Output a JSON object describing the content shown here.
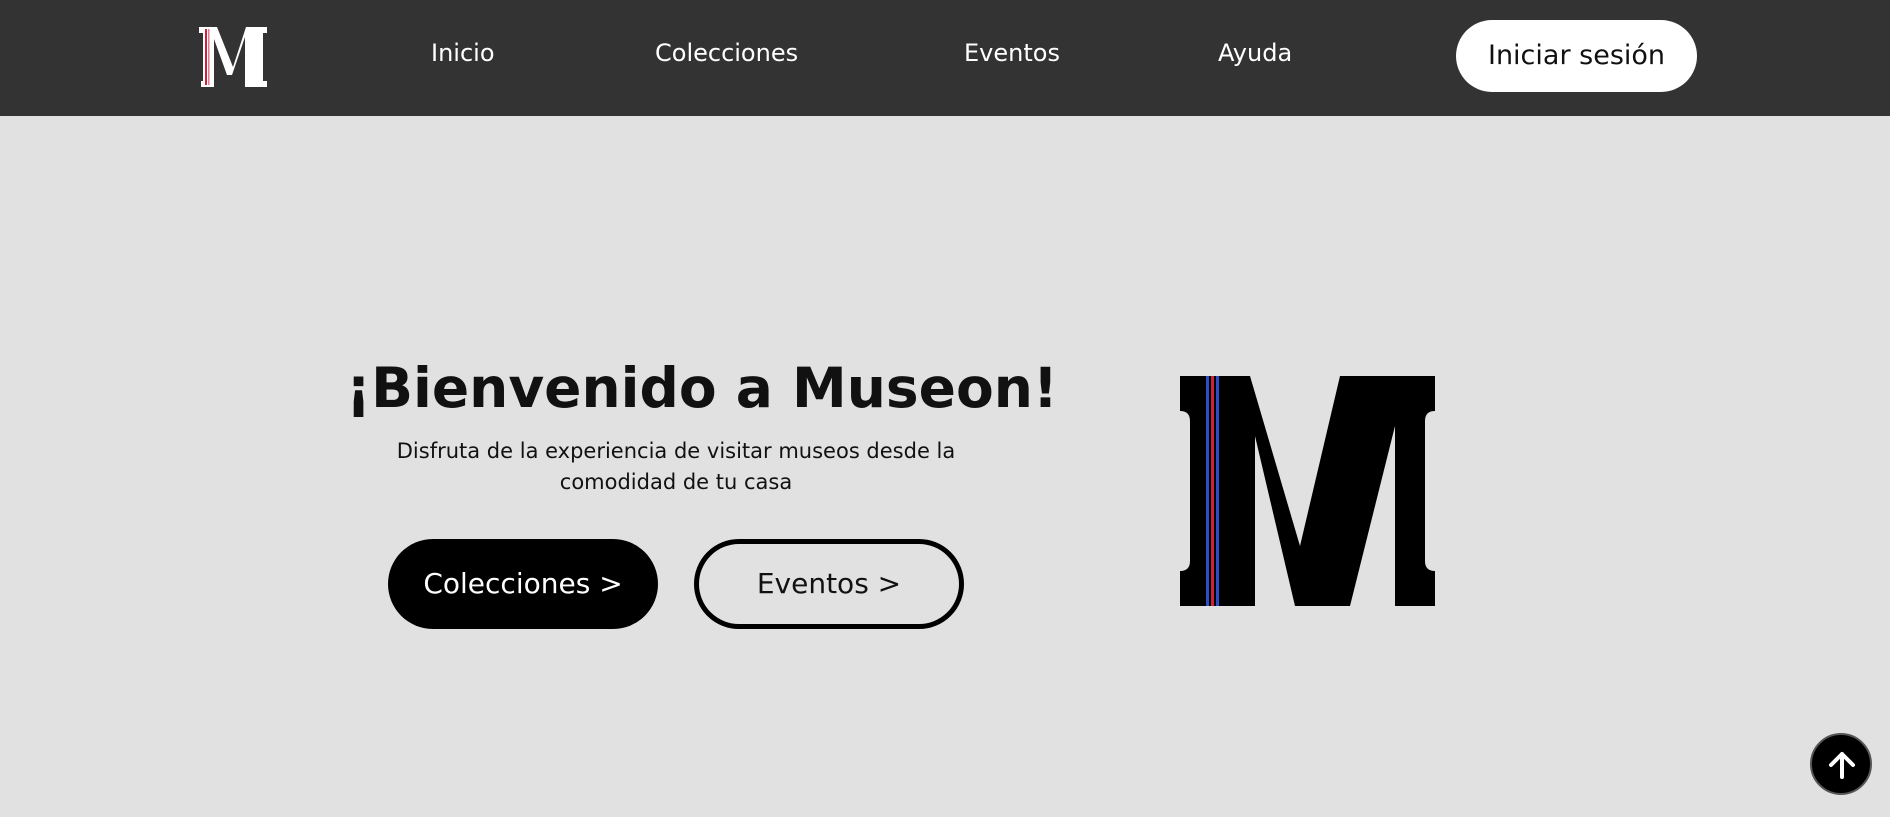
{
  "nav": {
    "logo_icon": "museon-m-logo",
    "links": [
      {
        "label": "Inicio"
      },
      {
        "label": "Colecciones"
      },
      {
        "label": "Eventos"
      },
      {
        "label": "Ayuda"
      }
    ],
    "login_label": "Iniciar sesión"
  },
  "hero": {
    "title": "¡Bienvenido a Museon!",
    "subtitle": "Disfruta de la experiencia de visitar museos desde la comodidad de tu casa",
    "primary_button": "Colecciones >",
    "secondary_button": "Eventos >",
    "logo_icon": "museon-m-logo"
  },
  "scroll_top": {
    "icon": "arrow-up-icon"
  },
  "colors": {
    "navbar": "#333333",
    "page_background": "#e1e1e1",
    "primary": "#000000",
    "logo_stripe_red": "#d0203a",
    "logo_stripe_blue": "#2a4fc9"
  }
}
